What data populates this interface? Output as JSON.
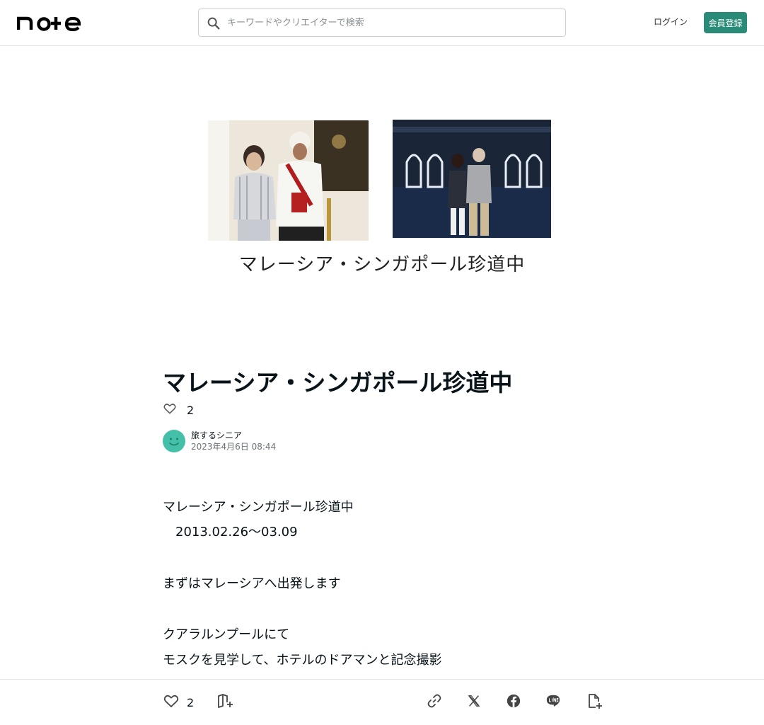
{
  "header": {
    "logo_text": "note",
    "search_placeholder": "キーワードやクリエイターで検索",
    "login_label": "ログイン",
    "signup_label": "会員登録"
  },
  "hero": {
    "caption": "マレーシア・シンガポール珍道中"
  },
  "article": {
    "title": "マレーシア・シンガポール珍道中",
    "likes": "2",
    "author_name": "旅するシニア",
    "published": "2023年4月6日 08:44",
    "lines": [
      "マレーシア・シンガポール珍道中",
      "　2013.02.26～03.09",
      "まずはマレーシアへ出発します",
      "クアラルンプールにて",
      "モスクを見学して、ホテルのドアマンと記念撮影",
      "＿＿＿＿＿＿＿＿＿＿＿＿＿＿＿＿＿＿＿＿＿＿＿"
    ]
  },
  "footer": {
    "likes": "2"
  },
  "colors": {
    "accent": "#2a8c78",
    "text": "#08131a",
    "muted": "#6b7378"
  },
  "icons": [
    "search-icon",
    "heart-icon",
    "magazine-add-icon",
    "link-icon",
    "x-icon",
    "facebook-icon",
    "line-icon",
    "embed-icon",
    "avatar-icon"
  ]
}
